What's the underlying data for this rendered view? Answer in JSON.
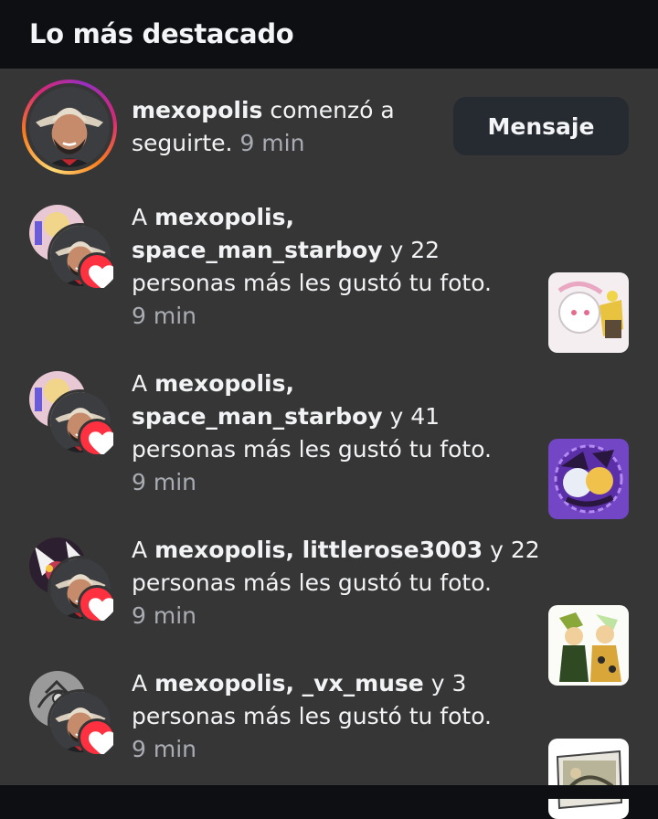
{
  "header": {
    "title": "Lo más destacado"
  },
  "follow": {
    "username": "mexopolis",
    "text_a": "comenzó a",
    "text_b": "seguirte.",
    "time": "9 min",
    "button_label": "Mensaje"
  },
  "notifications": [
    {
      "prefix": "A",
      "user1": "mexopolis,",
      "user2": "space_man_starboy",
      "tail1": "y 22",
      "tail2": "personas más les gustó tu foto.",
      "time": "9 min"
    },
    {
      "prefix": "A",
      "user1": "mexopolis,",
      "user2": "space_man_starboy",
      "tail1": "y 41",
      "tail2": "personas más les gustó tu foto.",
      "time": "9 min"
    },
    {
      "prefix": "A",
      "user1": "mexopolis, littlerose3003",
      "tail1": "y 22",
      "tail2": "personas más les gustó tu foto.",
      "time": "9 min"
    },
    {
      "prefix": "A",
      "user1": "mexopolis, _vx_muse",
      "tail1": "y 3",
      "tail2": "personas más les gustó tu foto.",
      "time": "9 min"
    }
  ],
  "colors": {
    "heart": "#ff3040",
    "panel": "#363636",
    "header": "#0d0f12",
    "button": "#262a31"
  },
  "icons": {
    "heart": "heart-icon"
  }
}
